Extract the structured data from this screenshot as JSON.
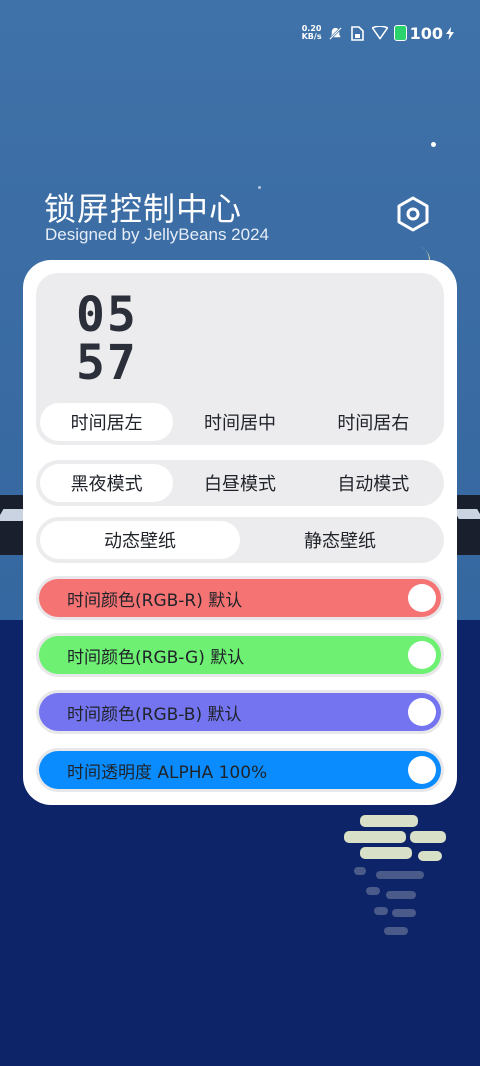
{
  "status_bar": {
    "net_speed_value": "0.20",
    "net_speed_unit": "KB/s",
    "battery_level": "100",
    "icons": [
      "mute-icon",
      "sim-icon",
      "wifi-icon",
      "battery-icon",
      "charging-icon"
    ]
  },
  "header": {
    "title": "锁屏控制中心",
    "subtitle": "Designed by JellyBeans 2024",
    "settings_icon": "hexagon-settings-icon"
  },
  "clock": {
    "hours": "05",
    "minutes": "57"
  },
  "alignment": {
    "options": [
      "时间居左",
      "时间居中",
      "时间居右"
    ],
    "selected": "时间居左"
  },
  "theme_mode": {
    "options": [
      "黑夜模式",
      "白昼模式",
      "自动模式"
    ],
    "selected": "黑夜模式"
  },
  "wallpaper": {
    "options": [
      "动态壁纸",
      "静态壁纸"
    ],
    "selected": "动态壁纸"
  },
  "sliders": [
    {
      "label": "时间颜色(RGB-R) 默认",
      "color": "#f57373"
    },
    {
      "label": "时间颜色(RGB-G) 默认",
      "color": "#6ef072"
    },
    {
      "label": "时间颜色(RGB-B) 默认",
      "color": "#7474f0"
    },
    {
      "label": "时间透明度 ALPHA 100%",
      "color": "#0a8cff"
    }
  ],
  "colors": {
    "card_bg": "#ffffff",
    "panel_bg": "#ececee",
    "bg_top": "#3a6ba3",
    "bg_bottom": "#0d2468"
  }
}
